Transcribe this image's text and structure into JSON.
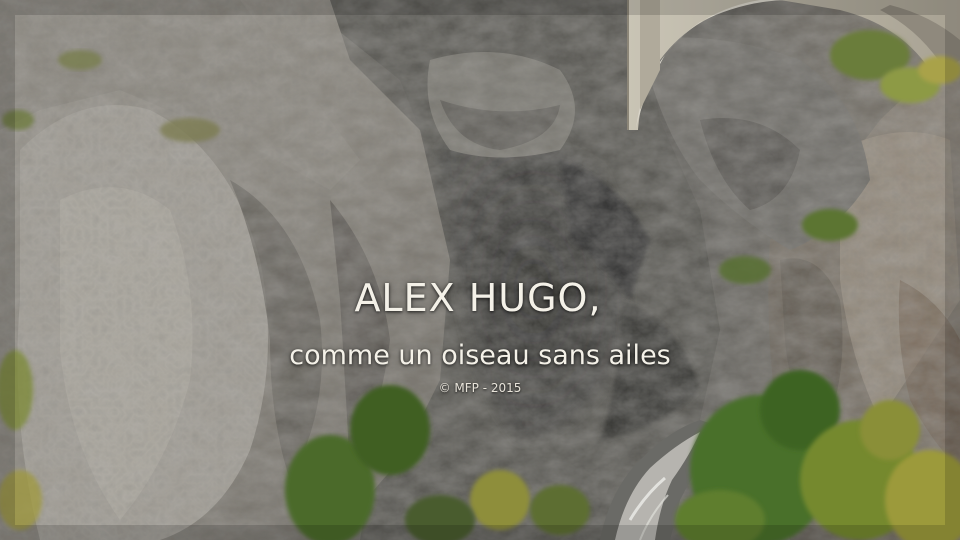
{
  "titles": {
    "main": "ALEX HUGO,",
    "subtitle": "comme un oiseau sans ailes",
    "copyright": "© MFP - 2015"
  },
  "palette": {
    "rock_light": "#8f8c86",
    "rock_mid": "#6e6c67",
    "rock_dark": "#3c3b38",
    "vegetation": "#5d7a2e",
    "vegetation_autumn": "#9c9a3a",
    "bridge_stone": "#b9b4a6",
    "water": "#c9c7c2",
    "title_text": "#f4f1e8"
  }
}
